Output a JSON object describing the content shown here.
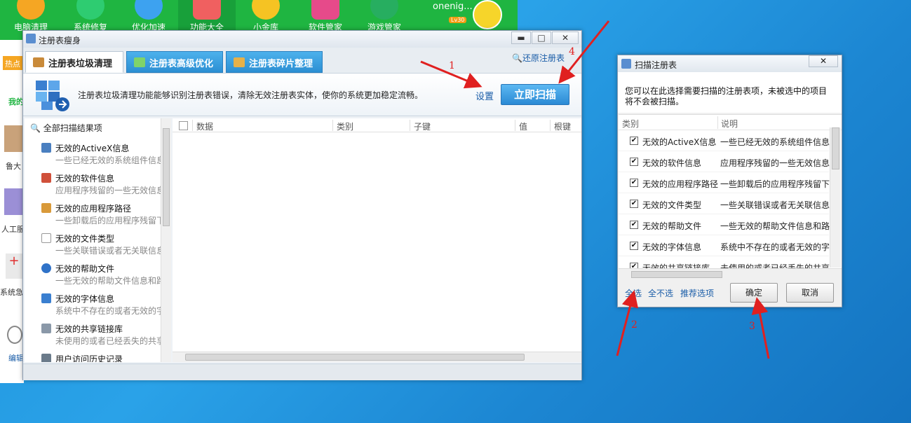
{
  "bg_app": {
    "tabs": [
      "电脑清理",
      "系统修复",
      "优化加速",
      "功能大全",
      "小金库",
      "软件管家",
      "游戏管家"
    ],
    "user": "onenig...",
    "level": "Lv30",
    "hot": "热点",
    "side": [
      "我的",
      "鲁大",
      "人工服",
      "系统急",
      "编辑"
    ]
  },
  "main": {
    "title": "注册表瘦身",
    "min": "▬",
    "max": "□",
    "close": "✕",
    "tabs": [
      "注册表垃圾清理",
      "注册表高级优化",
      "注册表碎片整理"
    ],
    "restore": "还原注册表",
    "desc": "注册表垃圾清理功能能够识别注册表错误，清除无效注册表实体，使你的系统更加稳定流畅。",
    "settings": "设置",
    "scan": "立即扫描",
    "tree_root": "全部扫描结果项",
    "tree": [
      {
        "name": "无效的ActiveX信息",
        "desc": "一些已经无效的系统组件信息"
      },
      {
        "name": "无效的软件信息",
        "desc": "应用程序残留的一些无效信息"
      },
      {
        "name": "无效的应用程序路径",
        "desc": "一些卸载后的应用程序残留下"
      },
      {
        "name": "无效的文件类型",
        "desc": "一些关联错误或者无关联信息"
      },
      {
        "name": "无效的帮助文件",
        "desc": "一些无效的帮助文件信息和路"
      },
      {
        "name": "无效的字体信息",
        "desc": "系统中不存在的或者无效的字"
      },
      {
        "name": "无效的共享链接库",
        "desc": "未使用的或者已经丢失的共享"
      },
      {
        "name": "用户访问历史记录",
        "desc": ""
      }
    ],
    "columns": [
      "数据",
      "类别",
      "子键",
      "值",
      "根键"
    ]
  },
  "dialog": {
    "title": "扫描注册表",
    "close": "✕",
    "desc": "您可以在此选择需要扫描的注册表项，未被选中的项目将不会被扫描。",
    "col_type": "类别",
    "col_desc": "说明",
    "rows": [
      {
        "name": "无效的ActiveX信息",
        "desc": "一些已经无效的系统组件信息"
      },
      {
        "name": "无效的软件信息",
        "desc": "应用程序残留的一些无效信息"
      },
      {
        "name": "无效的应用程序路径",
        "desc": "一些卸载后的应用程序残留下"
      },
      {
        "name": "无效的文件类型",
        "desc": "一些关联错误或者无关联信息"
      },
      {
        "name": "无效的帮助文件",
        "desc": "一些无效的帮助文件信息和路"
      },
      {
        "name": "无效的字体信息",
        "desc": "系统中不存在的或者无效的字"
      },
      {
        "name": "无效的共享链接库",
        "desc": "未使用的或者已经丢失的共享"
      }
    ],
    "check": "✔",
    "select_all": "全选",
    "select_none": "全不选",
    "recommended": "推荐选项",
    "ok": "确定",
    "cancel": "取消"
  },
  "annotations": [
    "1",
    "2",
    "3",
    "4"
  ],
  "colors": {
    "green": "#1fb541",
    "blue": "#2b8ad4",
    "link": "#1a5da8",
    "arrow": "#e02020"
  }
}
